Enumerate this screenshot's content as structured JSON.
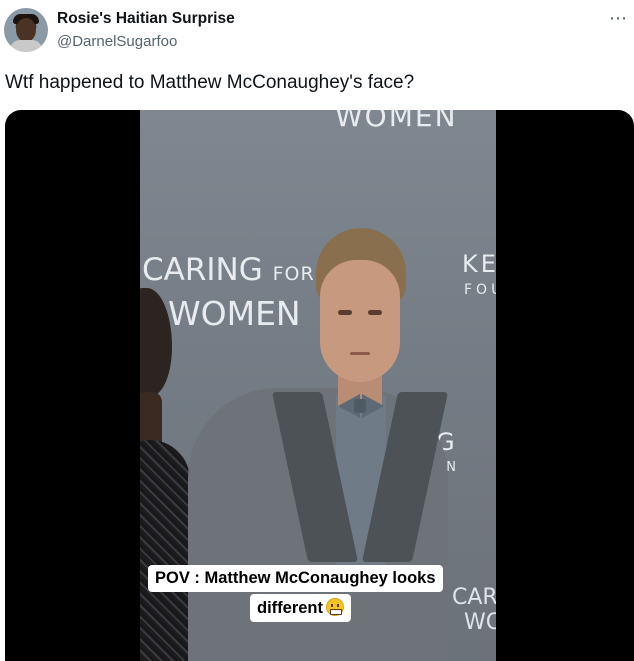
{
  "tweet": {
    "display_name": "Rosie's Haitian Surprise",
    "handle": "@DarnelSugarfoo",
    "more_icon": "⋯",
    "text": "Wtf happened to Matthew McConaughey's face?"
  },
  "media": {
    "backdrop": {
      "top_text": "WOMEN",
      "caring": "CARING",
      "for": "FOR",
      "women": "WOMEN",
      "ke": "KE",
      "fo": "FOU",
      "g": "G",
      "on": "ON",
      "car": "CAR",
      "wo": "WO"
    },
    "caption_line1": "POV : Matthew McConaughey looks",
    "caption_line2": "different",
    "caption_emoji": "grimacing-face-icon"
  }
}
